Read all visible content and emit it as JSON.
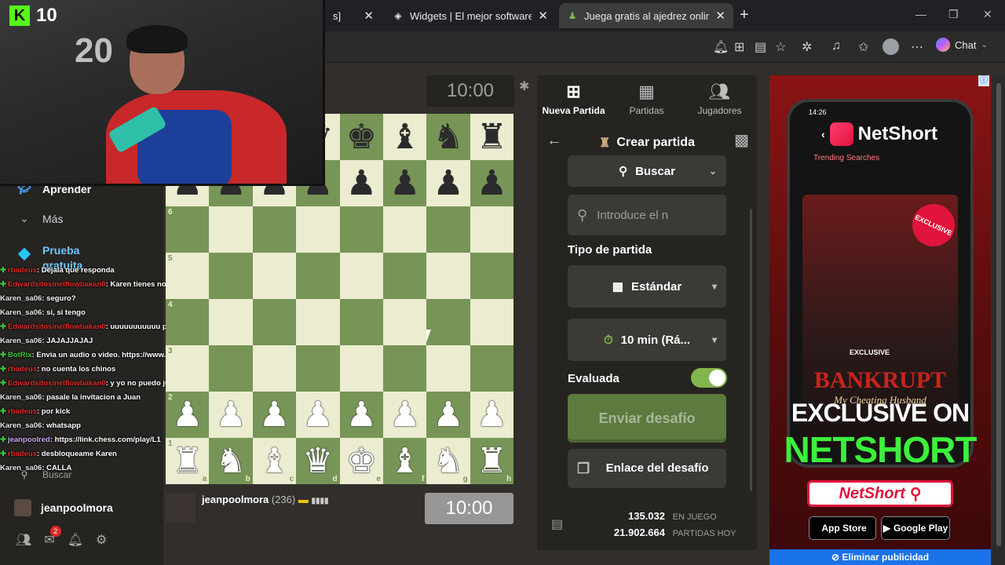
{
  "browser": {
    "tabs": [
      {
        "title": "s]",
        "active": false
      },
      {
        "title": "Widgets | El mejor software para p",
        "active": false
      },
      {
        "title": "Juega gratis al ajedrez online con",
        "active": true
      }
    ],
    "chat_label": "Chat"
  },
  "webcam": {
    "kick_viewers": "10",
    "balloon_text": "20"
  },
  "sidebar": {
    "items": [
      {
        "label": "Aprender",
        "icon": "graduation-icon"
      },
      {
        "label": "Más",
        "icon": "chevron-down-icon"
      },
      {
        "label": "Prueba gratuita",
        "icon": "diamond-icon"
      }
    ],
    "search_label": "Buscar",
    "username": "jeanpoolmora",
    "notification_count": "2"
  },
  "stream_chat": [
    {
      "user": "rbadeus",
      "user_color": "#e02828",
      "msg": ": Déjala que responda",
      "badge": true
    },
    {
      "user": "Edwardsitosinelflowbakan0",
      "user_color": "#e02828",
      "msg": ": Karen tienes novio/?",
      "badge": true
    },
    {
      "user": "Karen_sa06",
      "user_color": "#e8e8e8",
      "msg": ": seguro?",
      "badge": false
    },
    {
      "user": "Karen_sa06",
      "user_color": "#e8e8e8",
      "msg": ": si, si tengo",
      "badge": false
    },
    {
      "user": "Edwardsitosinelflowbakan0",
      "user_color": "#e02828",
      "msg": ": uuuuuuuuuuu por las huevas",
      "badge": true
    },
    {
      "user": "Karen_sa06",
      "user_color": "#e8e8e8",
      "msg": ": JAJAJJAJAJ",
      "badge": false
    },
    {
      "user": "BotRix",
      "user_color": "#3ec53e",
      "msg": ": Envia un audio o video. https://www.donoclip.com/jeanpoolred",
      "badge": true
    },
    {
      "user": "rbadeus",
      "user_color": "#e02828",
      "msg": ": no cuenta los chinos",
      "badge": true
    },
    {
      "user": "Edwardsitosinelflowbakan0",
      "user_color": "#e02828",
      "msg": ": y yo no puedo jugar",
      "badge": true
    },
    {
      "user": "Karen_sa06",
      "user_color": "#e8e8e8",
      "msg": ": pasale la invitacion a Juan",
      "badge": false
    },
    {
      "user": "rbadeus",
      "user_color": "#e02828",
      "msg": ": por kick",
      "badge": true
    },
    {
      "user": "Karen_sa06",
      "user_color": "#e8e8e8",
      "msg": ": whatsapp",
      "badge": false
    },
    {
      "user": "jeanpoolred",
      "user_color": "#c9a6ff",
      "msg": ": https://link.chess.com/play/L1",
      "badge": true
    },
    {
      "user": "rbadeus",
      "user_color": "#e02828",
      "msg": ": desbloqueame Karen",
      "badge": true
    },
    {
      "user": "Karen_sa06",
      "user_color": "#e8e8e8",
      "msg": ": CALLA",
      "badge": false
    }
  ],
  "game": {
    "clock_top": "10:00",
    "clock_bottom": "10:00",
    "player_bottom": {
      "name": "jeanpoolmora",
      "rating": "(236)"
    },
    "ranks_visible": [
      "6",
      "5",
      "4",
      "3",
      "2",
      "1"
    ],
    "files": [
      "a",
      "b",
      "c",
      "d",
      "e",
      "f",
      "g",
      "h"
    ]
  },
  "panel": {
    "tabs": [
      {
        "label": "Nueva Partida",
        "icon": "plus-square-icon",
        "active": true
      },
      {
        "label": "Partidas",
        "icon": "board-icon",
        "active": false
      },
      {
        "label": "Jugadores",
        "icon": "people-icon",
        "active": false
      }
    ],
    "title": "Crear partida",
    "buscar_label": "Buscar",
    "search_placeholder": "Introduce el n",
    "tipo_label": "Tipo de partida",
    "tipo_value": "Estándar",
    "time_value": "10 min (Rá...",
    "evaluada_label": "Evaluada",
    "evaluada_on": true,
    "send_label": "Enviar desafío",
    "link_label": "Enlace del desafío",
    "stats": [
      {
        "value": "135.032",
        "label": "EN JUEGO"
      },
      {
        "value": "21.902.664",
        "label": "PARTIDAS HOY"
      }
    ]
  },
  "ad": {
    "phone_time": "14:26",
    "brand": "NetShort",
    "trending": "Trending Searches",
    "show_title": "BANKRUPT",
    "show_subtitle": "My Cheating Husband",
    "exclusive_tag": "EXCLUSIVE",
    "badge": "EXCLUSIVE",
    "line1": "EXCLUSIVE ON",
    "line2": "NETSHORT",
    "search_brand": "NetShort",
    "app_store": "App Store",
    "google_play": "Google Play",
    "remove_label": "Eliminar publicidad"
  }
}
